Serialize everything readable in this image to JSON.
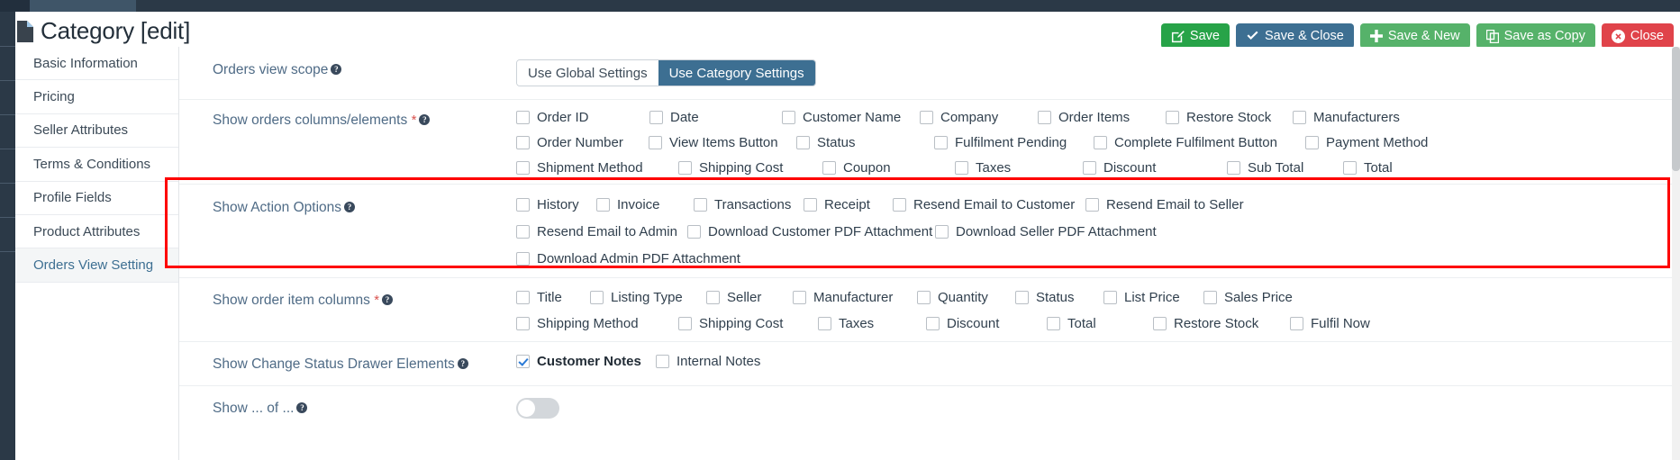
{
  "header": {
    "title": "Category [edit]",
    "icon": "document-icon"
  },
  "toolbar": {
    "buttons": [
      {
        "label": "Save",
        "icon": "pencil-square-icon",
        "glyph": "✎",
        "color": "#27a348"
      },
      {
        "label": "Save & Close",
        "icon": "check-icon",
        "glyph": "✔",
        "color": "#3d6f92"
      },
      {
        "label": "Save & New",
        "icon": "plus-icon",
        "glyph": "✚",
        "color": "#56b26a"
      },
      {
        "label": "Save as Copy",
        "icon": "copy-icon",
        "glyph": "❐",
        "color": "#56b26a"
      },
      {
        "label": "Close",
        "icon": "close-circle-icon",
        "glyph": "✖",
        "color": "#e0434a"
      }
    ]
  },
  "sidebar": {
    "items": [
      {
        "label": "Basic Information",
        "active": false
      },
      {
        "label": "Pricing",
        "active": false
      },
      {
        "label": "Seller Attributes",
        "active": false
      },
      {
        "label": "Terms & Conditions",
        "active": false
      },
      {
        "label": "Profile Fields",
        "active": false
      },
      {
        "label": "Product Attributes",
        "active": false
      },
      {
        "label": "Orders View Setting",
        "active": true
      }
    ]
  },
  "form": {
    "rows": [
      {
        "id": "orders-view-scope",
        "label": "Orders view scope",
        "required": false,
        "help": true,
        "type": "button-group",
        "options": [
          {
            "label": "Use Global Settings",
            "active": false
          },
          {
            "label": "Use Category Settings",
            "active": true
          }
        ]
      },
      {
        "id": "show-orders-columns",
        "label": "Show orders columns/elements",
        "required": true,
        "help": true,
        "type": "checkbox-grid",
        "lines": [
          [
            {
              "label": "Order ID",
              "checked": false
            },
            {
              "label": "Date",
              "checked": false
            },
            {
              "label": "Customer Name",
              "checked": false
            },
            {
              "label": "Company",
              "checked": false
            },
            {
              "label": "Order Items",
              "checked": false
            },
            {
              "label": "Restore Stock",
              "checked": false
            },
            {
              "label": "Manufacturers",
              "checked": false
            }
          ],
          [
            {
              "label": "Order Number",
              "checked": false
            },
            {
              "label": "View Items Button",
              "checked": false
            },
            {
              "label": "Status",
              "checked": false
            },
            {
              "label": "Fulfilment Pending",
              "checked": false
            },
            {
              "label": "Complete Fulfilment Button",
              "checked": false
            },
            {
              "label": "Payment Method",
              "checked": false
            }
          ],
          [
            {
              "label": "Shipment Method",
              "checked": false
            },
            {
              "label": "Shipping Cost",
              "checked": false
            },
            {
              "label": "Coupon",
              "checked": false
            },
            {
              "label": "Taxes",
              "checked": false
            },
            {
              "label": "Discount",
              "checked": false
            },
            {
              "label": "Sub Total",
              "checked": false
            },
            {
              "label": "Total",
              "checked": false
            }
          ]
        ]
      },
      {
        "id": "show-action-options",
        "label": "Show Action Options",
        "required": false,
        "help": true,
        "type": "checkbox-grid",
        "highlighted": true,
        "lines": [
          [
            {
              "label": "History",
              "checked": false
            },
            {
              "label": "Invoice",
              "checked": false
            },
            {
              "label": "Transactions",
              "checked": false
            },
            {
              "label": "Receipt",
              "checked": false
            },
            {
              "label": "Resend Email to Customer",
              "checked": false
            },
            {
              "label": "Resend Email to Seller",
              "checked": false
            }
          ],
          [
            {
              "label": "Resend Email to Admin",
              "checked": false
            },
            {
              "label": "Download Customer PDF Attachment",
              "checked": false
            },
            {
              "label": "Download Seller PDF Attachment",
              "checked": false
            }
          ],
          [
            {
              "label": "Download Admin PDF Attachment",
              "checked": false
            }
          ]
        ]
      },
      {
        "id": "show-order-item-columns",
        "label": "Show order item columns",
        "required": true,
        "help": true,
        "type": "checkbox-grid",
        "lines": [
          [
            {
              "label": "Title",
              "checked": false
            },
            {
              "label": "Listing Type",
              "checked": false
            },
            {
              "label": "Seller",
              "checked": false
            },
            {
              "label": "Manufacturer",
              "checked": false
            },
            {
              "label": "Quantity",
              "checked": false
            },
            {
              "label": "Status",
              "checked": false
            },
            {
              "label": "List Price",
              "checked": false
            },
            {
              "label": "Sales Price",
              "checked": false
            }
          ],
          [
            {
              "label": "Shipping Method",
              "checked": false
            },
            {
              "label": "Shipping Cost",
              "checked": false
            },
            {
              "label": "Taxes",
              "checked": false
            },
            {
              "label": "Discount",
              "checked": false
            },
            {
              "label": "Total",
              "checked": false
            },
            {
              "label": "Restore Stock",
              "checked": false
            },
            {
              "label": "Fulfil Now",
              "checked": false
            }
          ]
        ]
      },
      {
        "id": "show-change-status-drawer-elements",
        "label": "Show Change Status Drawer Elements",
        "required": false,
        "help": true,
        "type": "checkbox-grid",
        "lines": [
          [
            {
              "label": "Customer Notes",
              "checked": true
            },
            {
              "label": "Internal Notes",
              "checked": false
            }
          ]
        ]
      },
      {
        "id": "show-partial-row",
        "label": "Show ... of ...",
        "required": false,
        "help": true,
        "type": "switch",
        "value": false
      }
    ]
  },
  "colors": {
    "accent": "#3d6f92",
    "save_green": "#27a348",
    "close_red": "#e0434a",
    "highlight_red": "#fe0000",
    "label_blue": "#4f6b86",
    "checked_blue": "#2a7ad6"
  }
}
